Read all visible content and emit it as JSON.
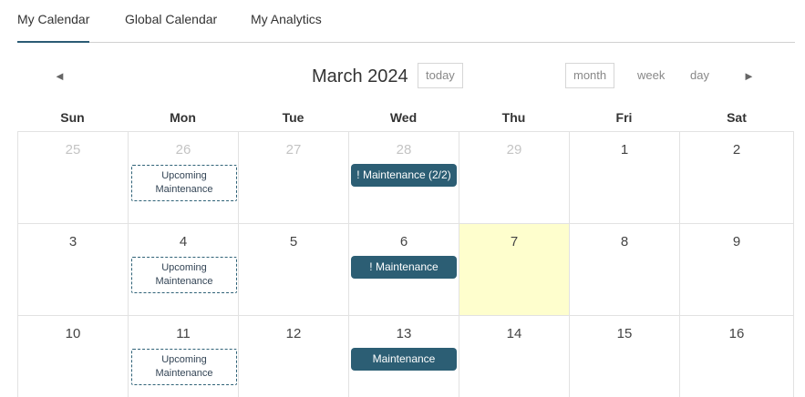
{
  "tabs": [
    {
      "label": "My Calendar",
      "active": true
    },
    {
      "label": "Global Calendar",
      "active": false
    },
    {
      "label": "My Analytics",
      "active": false
    }
  ],
  "toolbar": {
    "prev_icon": "◄",
    "next_icon": "►",
    "title": "March 2024",
    "today_label": "today",
    "month_label": "month",
    "week_label": "week",
    "day_label": "day"
  },
  "weekdays": [
    "Sun",
    "Mon",
    "Tue",
    "Wed",
    "Thu",
    "Fri",
    "Sat"
  ],
  "colors": {
    "accent": "#2c5e74",
    "today_bg": "#fefecd"
  },
  "weeks": [
    {
      "days": [
        {
          "num": "25",
          "muted": true
        },
        {
          "num": "26",
          "muted": true,
          "event": {
            "label": "Upcoming Maintenance",
            "style": "dashed"
          }
        },
        {
          "num": "27",
          "muted": true
        },
        {
          "num": "28",
          "muted": true,
          "event": {
            "label": "! Maintenance (2/2)",
            "style": "solid"
          }
        },
        {
          "num": "29",
          "muted": true
        },
        {
          "num": "1"
        },
        {
          "num": "2"
        }
      ]
    },
    {
      "days": [
        {
          "num": "3"
        },
        {
          "num": "4",
          "event": {
            "label": "Upcoming Maintenance",
            "style": "dashed"
          }
        },
        {
          "num": "5"
        },
        {
          "num": "6",
          "event": {
            "label": "! Maintenance",
            "style": "solid"
          }
        },
        {
          "num": "7",
          "today": true
        },
        {
          "num": "8"
        },
        {
          "num": "9"
        }
      ]
    },
    {
      "days": [
        {
          "num": "10"
        },
        {
          "num": "11",
          "event": {
            "label": "Upcoming Maintenance",
            "style": "dashed"
          }
        },
        {
          "num": "12"
        },
        {
          "num": "13",
          "event": {
            "label": "Maintenance",
            "style": "solid"
          }
        },
        {
          "num": "14"
        },
        {
          "num": "15"
        },
        {
          "num": "16"
        }
      ]
    }
  ]
}
